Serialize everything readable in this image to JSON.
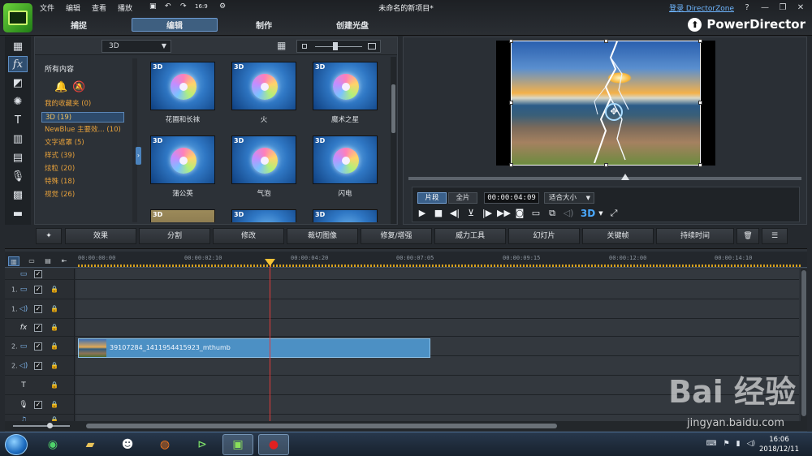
{
  "menu": {
    "file": "文件",
    "edit": "编辑",
    "view": "查看",
    "play": "播放"
  },
  "window_title": "未命名的新项目*",
  "topright": {
    "login": "登录 DirectorZone",
    "help": "?",
    "minimize": "—",
    "restore": "❐",
    "close": "✕"
  },
  "undo_ratio": "16:9",
  "tabs": {
    "capture": "捕捉",
    "edit": "编辑",
    "produce": "制作",
    "disc": "创建光盘"
  },
  "app_name": "PowerDirector",
  "library": {
    "filter": "3D",
    "all_content": "所有内容",
    "categories": [
      {
        "label": "我的收藏夹 (0)"
      },
      {
        "label": "3D  (19)"
      },
      {
        "label": "NewBlue 主要效... (10)"
      },
      {
        "label": "文字遮罩  (5)"
      },
      {
        "label": "样式  (39)"
      },
      {
        "label": "炫粒  (20)"
      },
      {
        "label": "特殊  (18)"
      },
      {
        "label": "视觉  (26)"
      }
    ],
    "thumbnails": [
      {
        "badge": "3D",
        "caption": "花圃和长袜"
      },
      {
        "badge": "3D",
        "caption": "火"
      },
      {
        "badge": "3D",
        "caption": "魔术之星"
      },
      {
        "badge": "3D",
        "caption": "蒲公英"
      },
      {
        "badge": "3D",
        "caption": "气泡"
      },
      {
        "badge": "3D",
        "caption": "闪电"
      },
      {
        "badge": "3D",
        "caption": ""
      },
      {
        "badge": "3D",
        "caption": ""
      },
      {
        "badge": "3D",
        "caption": ""
      }
    ]
  },
  "preview": {
    "clip": "片段",
    "full": "全片",
    "timecode": "00:00:04:09",
    "fit": "适合大小",
    "btn_3d": "3D"
  },
  "function_bar": {
    "effects": "效果",
    "split": "分割",
    "modify": "修改",
    "crop": "裁切图像",
    "fix": "修复/增强",
    "power_tools": "威力工具",
    "slideshow": "幻灯片",
    "keyframe": "关键帧",
    "duration": "持续时间"
  },
  "timeline": {
    "ticks": [
      "00:00:00:00",
      "00:00:02:10",
      "00:00:04:20",
      "00:00:07:05",
      "00:00:09:15",
      "00:00:12:00",
      "00:00:14:10"
    ],
    "tracks": [
      {
        "num": "",
        "icon": "video-icon"
      },
      {
        "num": "1.",
        "icon": "video-icon"
      },
      {
        "num": "1.",
        "icon": "audio-icon"
      },
      {
        "num": "",
        "icon": "fx-icon"
      },
      {
        "num": "2.",
        "icon": "video-icon"
      },
      {
        "num": "2.",
        "icon": "audio-icon"
      },
      {
        "num": "",
        "icon": "title-icon"
      },
      {
        "num": "",
        "icon": "voice-icon"
      },
      {
        "num": "",
        "icon": "music-icon"
      }
    ],
    "clip_name": "39107284_1411954415923_mthumb"
  },
  "taskbar": {
    "time": "16:06",
    "date": "2018/12/11"
  },
  "watermark": {
    "brand": "Bai 经验",
    "url": "jingyan.baidu.com"
  }
}
